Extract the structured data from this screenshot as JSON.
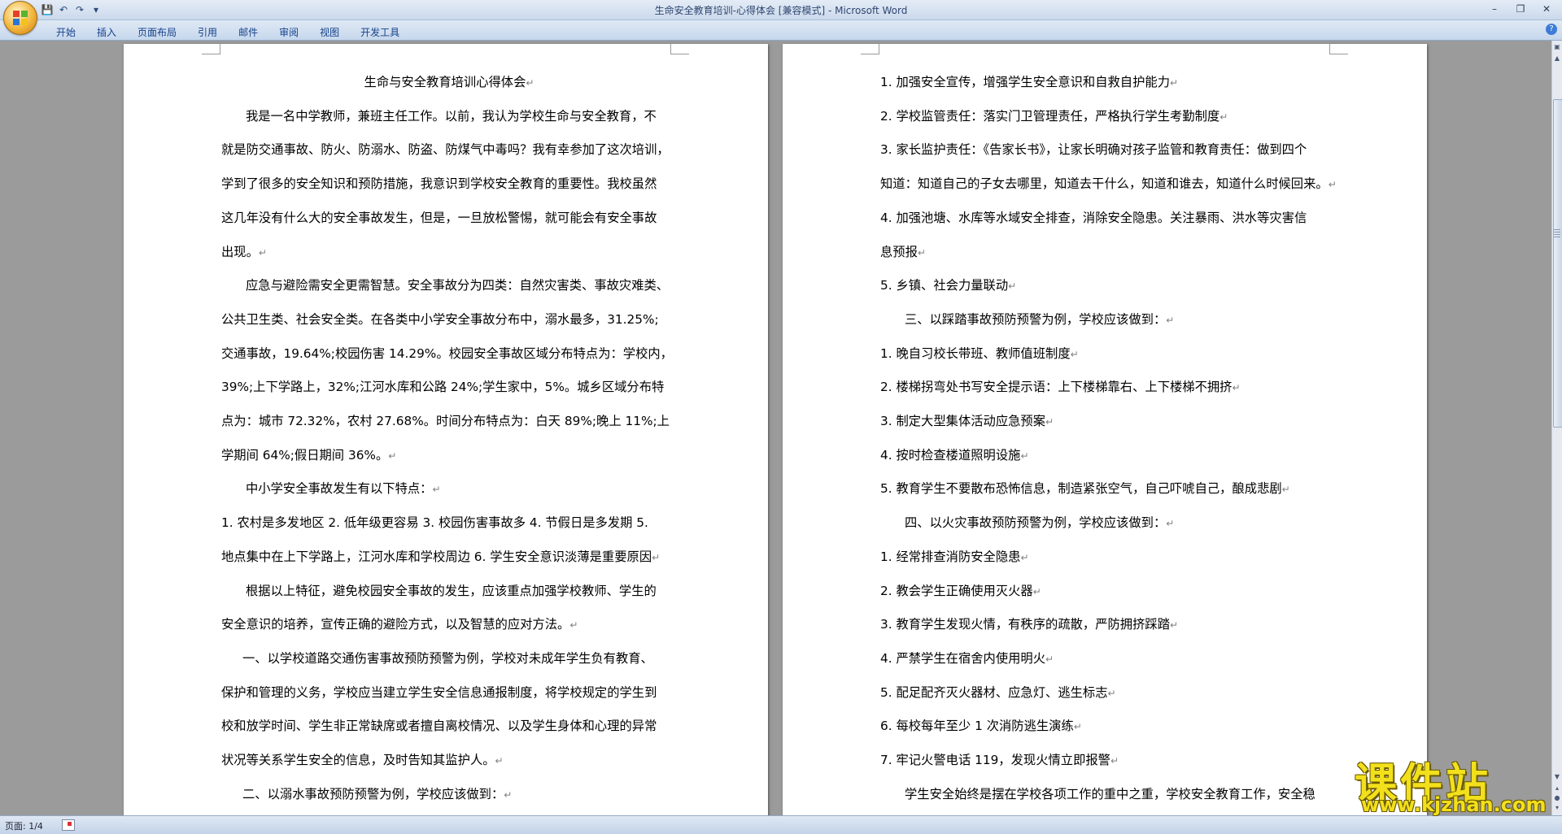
{
  "window": {
    "title": "生命安全教育培训-心得体会 [兼容模式] - Microsoft Word"
  },
  "ribbon": {
    "tabs": [
      "开始",
      "插入",
      "页面布局",
      "引用",
      "邮件",
      "审阅",
      "视图",
      "开发工具"
    ]
  },
  "page1": {
    "lines": [
      "生命与安全教育培训心得体会",
      "我是一名中学教师，兼班主任工作。以前，我认为学校生命与安全教育，不",
      "就是防交通事故、防火、防溺水、防盗、防煤气中毒吗？我有幸参加了这次培训，",
      "学到了很多的安全知识和预防措施，我意识到学校安全教育的重要性。我校虽然",
      "这几年没有什么大的安全事故发生，但是，一旦放松警惕，就可能会有安全事故",
      "出现。",
      "应急与避险需安全更需智慧。安全事故分为四类：自然灾害类、事故灾难类、",
      "公共卫生类、社会安全类。在各类中小学安全事故分布中，溺水最多，31.25%;",
      "交通事故，19.64%;校园伤害 14.29%。校园安全事故区域分布特点为：学校内，",
      "39%;上下学路上，32%;江河水库和公路 24%;学生家中，5%。城乡区域分布特",
      "点为：城市 72.32%，农村 27.68%。时间分布特点为：白天 89%;晚上 11%;上",
      "学期间 64%;假日期间 36%。",
      "中小学安全事故发生有以下特点：",
      "1. 农村是多发地区 2. 低年级更容易 3. 校园伤害事故多 4. 节假日是多发期 5.",
      "地点集中在上下学路上，江河水库和学校周边 6. 学生安全意识淡薄是重要原因",
      "根据以上特征，避免校园安全事故的发生，应该重点加强学校教师、学生的",
      "安全意识的培养，宣传正确的避险方式，以及智慧的应对方法。",
      "一、以学校道路交通伤害事故预防预警为例，学校对未成年学生负有教育、",
      "保护和管理的义务，学校应当建立学生安全信息通报制度，将学校规定的学生到",
      "校和放学时间、学生非正常缺席或者擅自离校情况、以及学生身体和心理的异常",
      "状况等关系学生安全的信息，及时告知其监护人。",
      "二、以溺水事故预防预警为例，学校应该做到："
    ]
  },
  "page2": {
    "lines": [
      "1. 加强安全宣传，增强学生安全意识和自救自护能力",
      "2. 学校监管责任：落实门卫管理责任，严格执行学生考勤制度",
      "3. 家长监护责任：《告家长书》，让家长明确对孩子监管和教育责任：做到四个",
      "知道：知道自己的子女去哪里，知道去干什么，知道和谁去，知道什么时候回来。",
      "4. 加强池塘、水库等水域安全排查，消除安全隐患。关注暴雨、洪水等灾害信",
      "息预报",
      "5. 乡镇、社会力量联动",
      "三、以踩踏事故预防预警为例，学校应该做到：",
      "1. 晚自习校长带班、教师值班制度",
      "2. 楼梯拐弯处书写安全提示语：上下楼梯靠右、上下楼梯不拥挤",
      "3. 制定大型集体活动应急预案",
      "4. 按时检查楼道照明设施",
      "5. 教育学生不要散布恐怖信息，制造紧张空气，自己吓唬自己，酿成悲剧",
      "四、以火灾事故预防预警为例，学校应该做到：",
      "1. 经常排查消防安全隐患",
      "2. 教会学生正确使用灭火器",
      "3. 教育学生发现火情，有秩序的疏散，严防拥挤踩踏",
      "4. 严禁学生在宿舍内使用明火",
      "5. 配足配齐灭火器材、应急灯、逃生标志",
      "6. 每校每年至少 1 次消防逃生演练",
      "7. 牢记火警电话 119，发现火情立即报警",
      "学生安全始终是摆在学校各项工作的重中之重，学校安全教育工作，安全稳"
    ]
  },
  "status": {
    "page": "页面: 1/4"
  },
  "watermark": {
    "cn": "课件站",
    "url": "www.kjzhan.com"
  }
}
